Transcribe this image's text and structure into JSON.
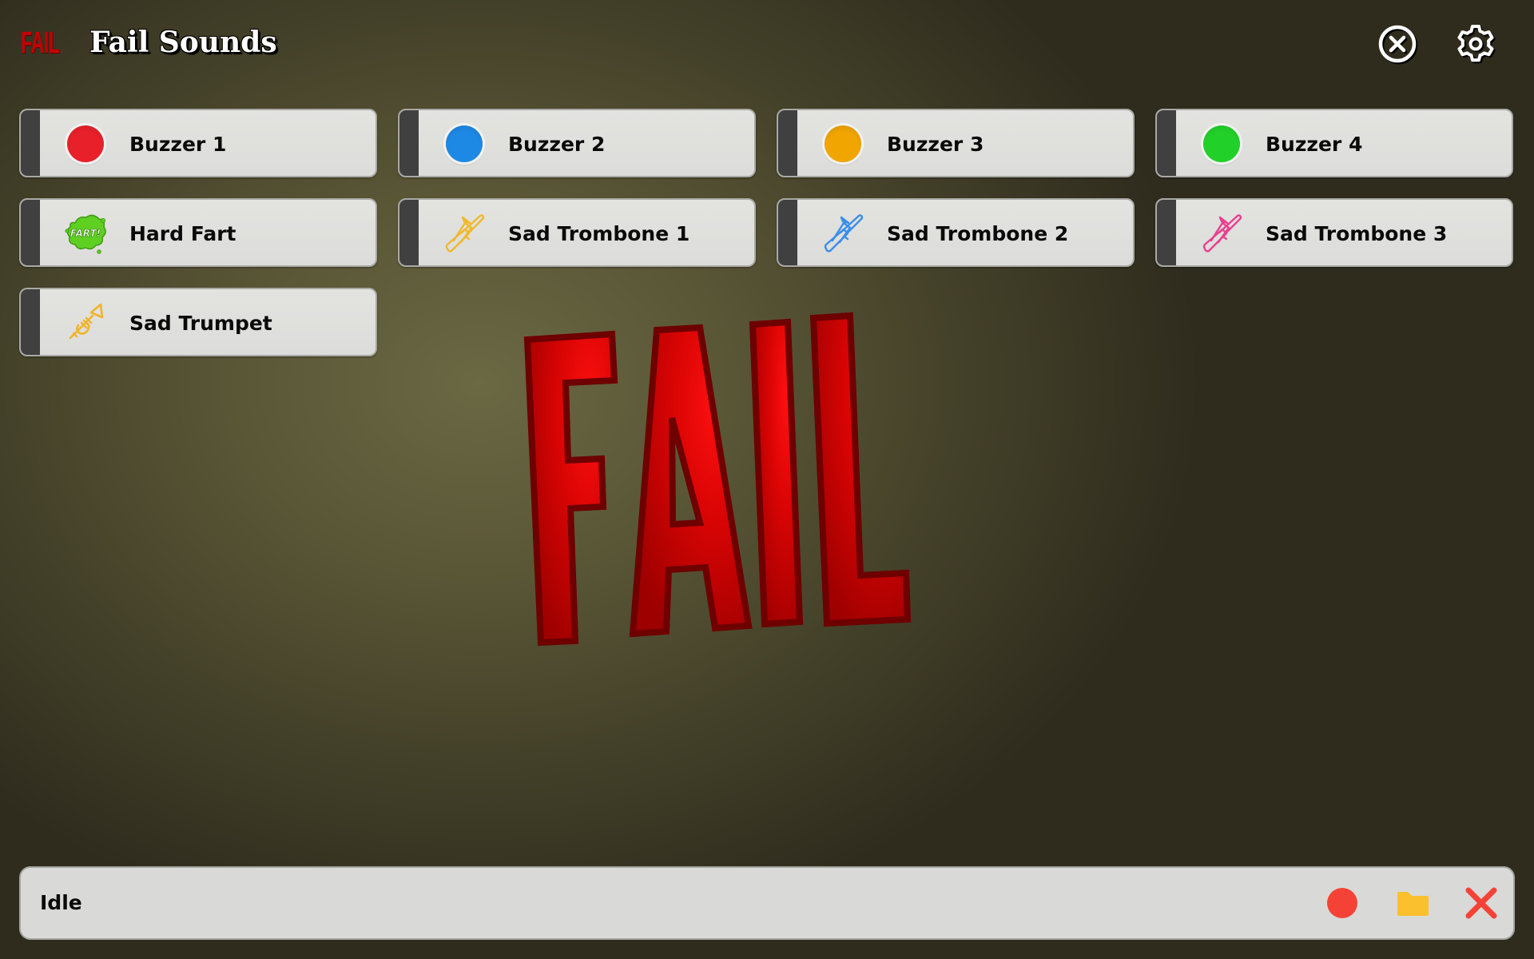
{
  "app": {
    "logo_text": "FAIL",
    "title": "Fail Sounds",
    "close_icon": "circle-x-icon",
    "settings_icon": "gear-icon"
  },
  "colors": {
    "accent_red": "#c40000",
    "tile_bg": "#e0e0de",
    "tile_stripe": "#404040",
    "record": "#f44336",
    "folder": "#fbc02d",
    "stop": "#f44336"
  },
  "sounds": [
    {
      "label": "Buzzer 1",
      "icon": "red-buzzer-icon",
      "color": "#e8202a"
    },
    {
      "label": "Buzzer 2",
      "icon": "blue-buzzer-icon",
      "color": "#1e88e5"
    },
    {
      "label": "Buzzer 3",
      "icon": "orange-buzzer-icon",
      "color": "#f0a500"
    },
    {
      "label": "Buzzer 4",
      "icon": "green-buzzer-icon",
      "color": "#22d02a"
    },
    {
      "label": "Hard Fart",
      "icon": "fart-cloud-icon",
      "color": "#5fcf22",
      "icon_text": "FART!"
    },
    {
      "label": "Sad Trombone 1",
      "icon": "trombone-icon",
      "color": "#f0b92e"
    },
    {
      "label": "Sad Trombone 2",
      "icon": "trombone-icon",
      "color": "#3a8ee8"
    },
    {
      "label": "Sad Trombone 3",
      "icon": "trombone-icon",
      "color": "#e8408f"
    },
    {
      "label": "Sad Trumpet",
      "icon": "trumpet-icon",
      "color": "#f0b42a"
    }
  ],
  "center_art": {
    "text": "FAIL"
  },
  "status": {
    "text": "Idle",
    "record_icon": "record-icon",
    "folder_icon": "folder-icon",
    "stop_icon": "close-x-icon"
  }
}
